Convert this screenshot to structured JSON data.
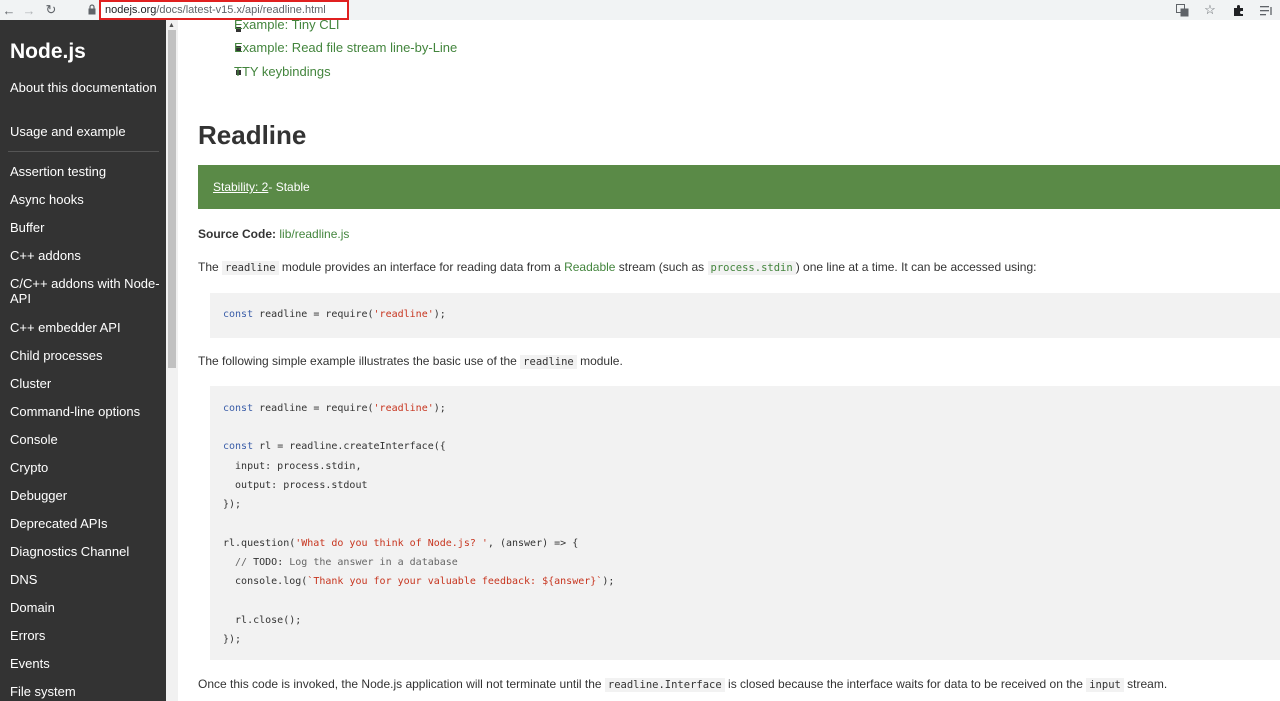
{
  "browser": {
    "url_host": "nodejs.org",
    "url_path": "/docs/latest-v15.x/api/readline.html"
  },
  "sidebar": {
    "brand": "Node.js",
    "items": [
      {
        "label": "About this documentation"
      },
      {
        "label": "Usage and example"
      },
      {
        "label": "Assertion testing"
      },
      {
        "label": "Async hooks"
      },
      {
        "label": "Buffer"
      },
      {
        "label": "C++ addons"
      },
      {
        "label": "C/C++ addons with Node-API"
      },
      {
        "label": "C++ embedder API"
      },
      {
        "label": "Child processes"
      },
      {
        "label": "Cluster"
      },
      {
        "label": "Command-line options"
      },
      {
        "label": "Console"
      },
      {
        "label": "Crypto"
      },
      {
        "label": "Debugger"
      },
      {
        "label": "Deprecated APIs"
      },
      {
        "label": "Diagnostics Channel"
      },
      {
        "label": "DNS"
      },
      {
        "label": "Domain"
      },
      {
        "label": "Errors"
      },
      {
        "label": "Events"
      },
      {
        "label": "File system"
      }
    ]
  },
  "toc": {
    "items": [
      "Example: Tiny CLI",
      "Example: Read file stream line-by-Line",
      "TTY keybindings"
    ]
  },
  "content": {
    "heading": "Readline",
    "stability_link": "Stability: 2",
    "stability_text": " - Stable",
    "source_label": "Source Code:",
    "source_link": "lib/readline.js",
    "p1_a": "The ",
    "p1_code1": "readline",
    "p1_b": " module provides an interface for reading data from a ",
    "p1_link": "Readable",
    "p1_c": " stream (such as ",
    "p1_code2": "process.stdin",
    "p1_d": ") one line at a time. It can be accessed using:",
    "code1": {
      "kw": "const",
      "mid": " readline = require(",
      "str": "'readline'",
      "end": ");"
    },
    "p2_a": "The following simple example illustrates the basic use of the ",
    "p2_code": "readline",
    "p2_b": " module.",
    "code2": {
      "l1_kw": "const",
      "l1_mid": " readline = require(",
      "l1_str": "'readline'",
      "l1_end": ");",
      "l2_kw": "const",
      "l2_mid": " rl = readline.createInterface({",
      "l3": "  input: process.stdin,",
      "l4": "  output: process.stdout",
      "l5": "});",
      "l6_a": "rl.question(",
      "l6_str": "'What do you think of Node.js? '",
      "l6_b": ", (answer) => {",
      "l7_cmt_a": "  // ",
      "l7_todo": "TODO:",
      "l7_cmt_b": " Log the answer in a database",
      "l8_a": "  console.log(",
      "l8_str": "`Thank you for your valuable feedback: ${answer}`",
      "l8_b": ");",
      "l9": "  rl.close();",
      "l10": "});"
    },
    "p3_a": "Once this code is invoked, the Node.js application will not terminate until the ",
    "p3_code1": "readline.Interface",
    "p3_b": " is closed because the interface waits for data to be received on the ",
    "p3_code2": "input",
    "p3_c": " stream."
  }
}
